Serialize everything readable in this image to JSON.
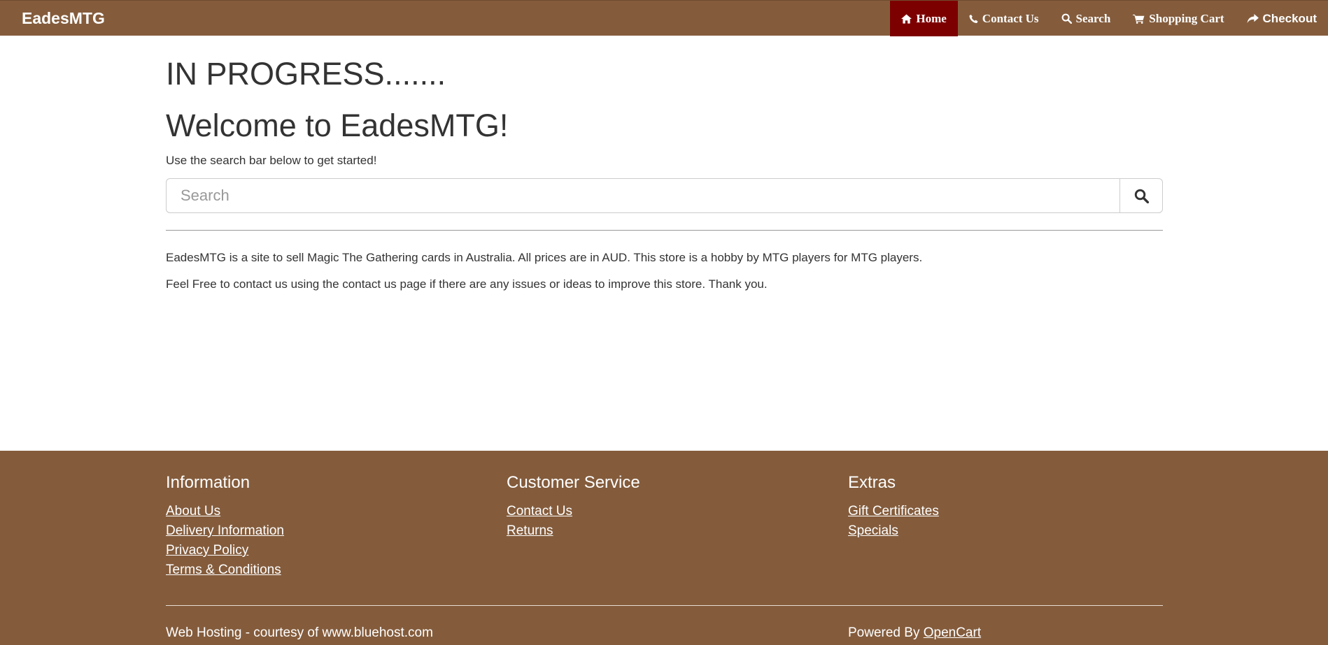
{
  "colors": {
    "nav_bg": "#845c3c",
    "nav_active_bg": "#7d0000",
    "footer_bg": "#845c3c",
    "text": "#333333"
  },
  "header": {
    "brand": "EadesMTG",
    "nav": [
      {
        "label": "Home",
        "icon": "home-icon",
        "active": true
      },
      {
        "label": "Contact Us",
        "icon": "phone-icon",
        "active": false
      },
      {
        "label": "Search",
        "icon": "search-icon",
        "active": false
      },
      {
        "label": "Shopping Cart",
        "icon": "cart-icon",
        "active": false
      },
      {
        "label": "Checkout",
        "icon": "share-icon",
        "active": false
      }
    ]
  },
  "main": {
    "progress_heading": "IN PROGRESS.......",
    "welcome_heading": "Welcome to EadesMTG!",
    "intro": "Use the search bar below to get started!",
    "search": {
      "placeholder": "Search",
      "value": "",
      "button_icon": "search-icon"
    },
    "description_1": "EadesMTG is a site to sell Magic The Gathering cards in Australia. All prices are in AUD. This store is a hobby by MTG players for MTG players.",
    "description_2": "Feel Free to contact us using the contact us page if there are any issues or ideas to improve this store. Thank you."
  },
  "footer": {
    "columns": [
      {
        "title": "Information",
        "links": [
          "About Us",
          "Delivery Information",
          "Privacy Policy",
          "Terms & Conditions"
        ]
      },
      {
        "title": "Customer Service",
        "links": [
          "Contact Us",
          "Returns"
        ]
      },
      {
        "title": "Extras",
        "links": [
          "Gift Certificates",
          "Specials"
        ]
      }
    ],
    "hosting": "Web Hosting - courtesy of www.bluehost.com",
    "powered_prefix": "Powered By",
    "powered_link": "OpenCart"
  }
}
